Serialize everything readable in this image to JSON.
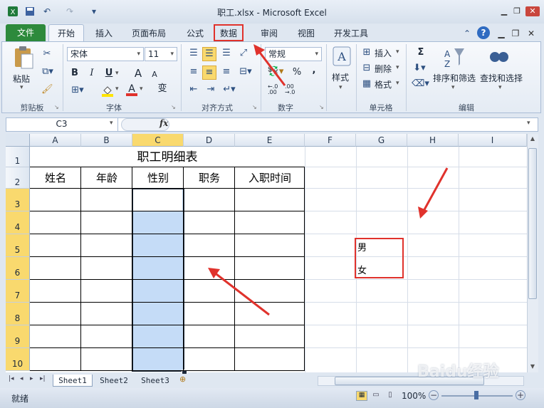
{
  "window": {
    "title": "职工.xlsx - Microsoft Excel"
  },
  "tabs": [
    "文件",
    "开始",
    "插入",
    "页面布局",
    "公式",
    "数据",
    "审阅",
    "视图",
    "开发工具"
  ],
  "ribbon": {
    "clipboard": {
      "paste": "粘贴",
      "label": "剪贴板"
    },
    "font": {
      "name": "宋体",
      "size": "11",
      "label": "字体",
      "bold": "B",
      "italic": "I",
      "underline": "U",
      "grow": "A",
      "shrink": "A",
      "wen": "变"
    },
    "align": {
      "label": "对齐方式"
    },
    "number": {
      "format": "常规",
      "label": "数字",
      "percent": "%",
      "comma": ","
    },
    "styles": {
      "label": "样式"
    },
    "cells": {
      "insert": "插入",
      "delete": "删除",
      "format": "格式",
      "label": "单元格"
    },
    "editing": {
      "sort": "排序和筛选",
      "find": "查找和选择",
      "label": "编辑",
      "sigma": "Σ"
    }
  },
  "formula_bar": {
    "name_box": "C3",
    "fx": "fx",
    "value": ""
  },
  "columns": [
    "A",
    "B",
    "C",
    "D",
    "E",
    "F",
    "G",
    "H",
    "I"
  ],
  "rows": [
    "1",
    "2",
    "3",
    "4",
    "5",
    "6",
    "7",
    "8",
    "9",
    "10"
  ],
  "table": {
    "title": "职工明细表",
    "headers": [
      "姓名",
      "年龄",
      "性别",
      "职务",
      "入职时间"
    ]
  },
  "source_list": [
    "男",
    "女"
  ],
  "sheets": [
    "Sheet1",
    "Sheet2",
    "Sheet3"
  ],
  "status": {
    "ready": "就绪",
    "zoom": "100%"
  },
  "watermark": "Baidu经验",
  "colors": {
    "file_tab": "#2d8a3c",
    "selection": "#c5dcf7",
    "highlight": "#f9d96e",
    "annotation": "#e0322c"
  }
}
